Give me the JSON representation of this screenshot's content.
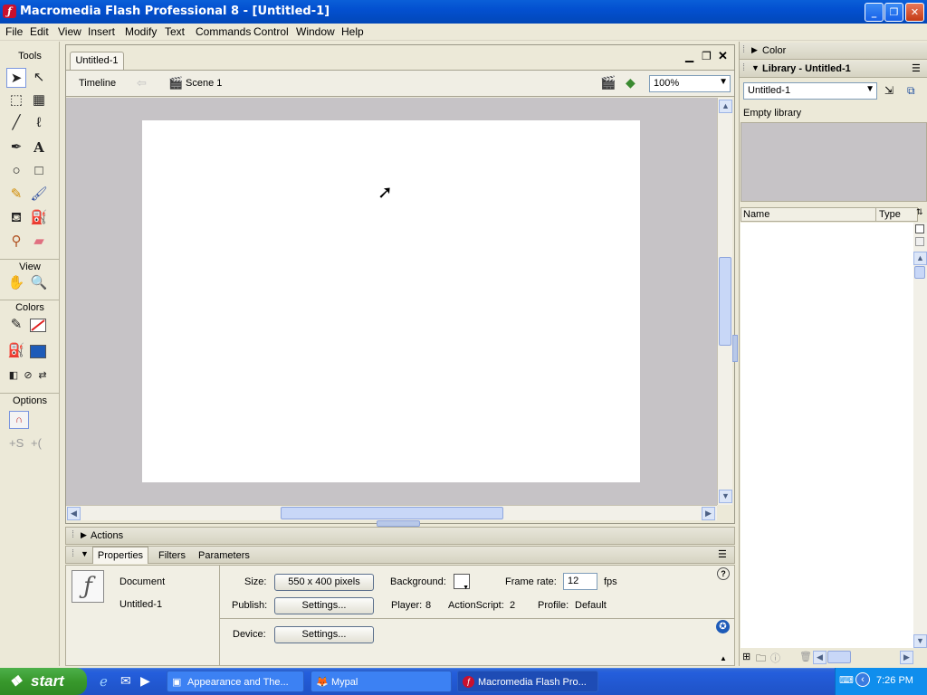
{
  "window": {
    "title": "Macromedia Flash Professional 8 - [Untitled-1]"
  },
  "menu": [
    "File",
    "Edit",
    "View",
    "Insert",
    "Modify",
    "Text",
    "Commands",
    "Control",
    "Window",
    "Help"
  ],
  "tools": {
    "header": "Tools",
    "view_label": "View",
    "colors_label": "Colors",
    "options_label": "Options",
    "stroke_color": "#E02020",
    "fill_color": "#1E5BB8"
  },
  "document": {
    "tab": "Untitled-1",
    "timeline_label": "Timeline",
    "scene_label": "Scene 1",
    "zoom": "100%"
  },
  "panels": {
    "actions_label": "Actions",
    "tabs": [
      "Properties",
      "Filters",
      "Parameters"
    ]
  },
  "properties": {
    "doc_type": "Document",
    "doc_name": "Untitled-1",
    "size_label": "Size:",
    "size_value": "550 x 400 pixels",
    "background_label": "Background:",
    "frame_rate_label": "Frame rate:",
    "frame_rate": "12",
    "fps": "fps",
    "publish_label": "Publish:",
    "settings_btn": "Settings...",
    "player_label": "Player:",
    "player_value": "8",
    "actionscript_label": "ActionScript:",
    "actionscript_value": "2",
    "profile_label": "Profile:",
    "profile_value": "Default",
    "device_label": "Device:",
    "device_settings_btn": "Settings..."
  },
  "right_panel": {
    "color_title": "Color",
    "library_title": "Library - Untitled-1",
    "library_select": "Untitled-1",
    "empty_label": "Empty library",
    "col_name": "Name",
    "col_type": "Type"
  },
  "taskbar": {
    "start": "start",
    "tasks": [
      "Appearance and The...",
      "Mypal",
      "Macromedia Flash Pro..."
    ],
    "time": "7:26 PM"
  }
}
